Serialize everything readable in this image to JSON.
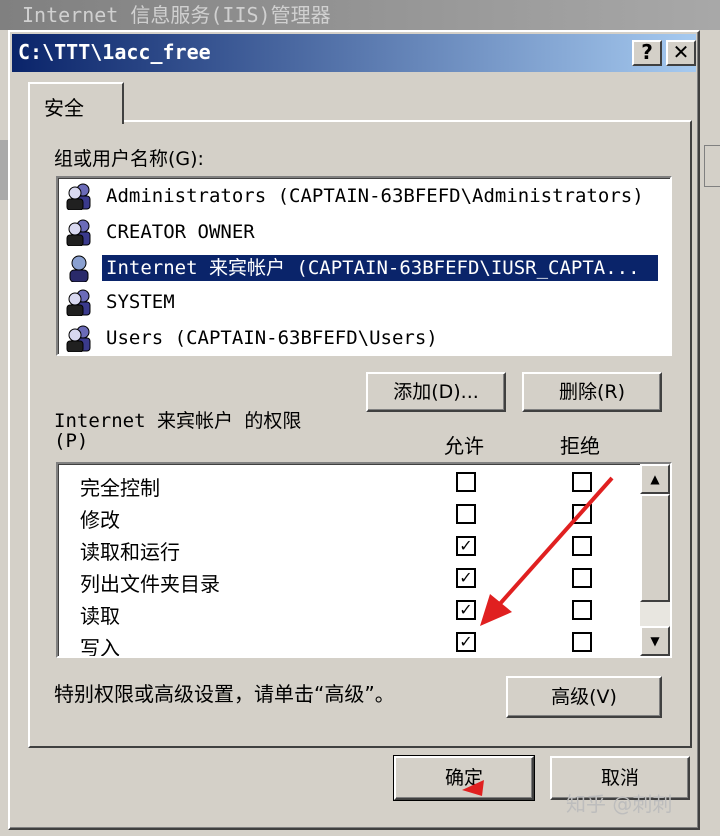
{
  "background_window": {
    "title": "Internet 信息服务(IIS)管理器"
  },
  "dialog": {
    "title": "C:\\TTT\\1acc_free",
    "help_button": "?",
    "close_button": "✕"
  },
  "tabs": [
    {
      "label": "安全"
    }
  ],
  "groups": {
    "label": "组或用户名称(G):",
    "items": [
      {
        "name": "Administrators (CAPTAIN-63BFEFD\\Administrators)",
        "icon": "user-group-icon",
        "selected": false
      },
      {
        "name": "CREATOR OWNER",
        "icon": "user-group-icon",
        "selected": false
      },
      {
        "name": "Internet 来宾帐户 (CAPTAIN-63BFEFD\\IUSR_CAPTA...",
        "icon": "user-icon",
        "selected": true
      },
      {
        "name": "SYSTEM",
        "icon": "user-group-icon",
        "selected": false
      },
      {
        "name": "Users (CAPTAIN-63BFEFD\\Users)",
        "icon": "user-group-icon",
        "selected": false
      }
    ],
    "add_button": "添加(D)...",
    "remove_button": "删除(R)"
  },
  "permissions": {
    "label_line1": "Internet 来宾帐户 的权限",
    "label_line2": "(P)",
    "allow_header": "允许",
    "deny_header": "拒绝",
    "rows": [
      {
        "name": "完全控制",
        "allow": false,
        "deny": false
      },
      {
        "name": "修改",
        "allow": false,
        "deny": false
      },
      {
        "name": "读取和运行",
        "allow": true,
        "deny": false
      },
      {
        "name": "列出文件夹目录",
        "allow": true,
        "deny": false
      },
      {
        "name": "读取",
        "allow": true,
        "deny": false
      },
      {
        "name": "写入",
        "allow": true,
        "deny": false
      }
    ]
  },
  "advanced": {
    "note": "特别权限或高级设置，请单击“高级”。",
    "button": "高级(V)"
  },
  "footer": {
    "ok_button": "确定",
    "cancel_button": "取消"
  },
  "watermark": "知乎 @刺刺",
  "colors": {
    "titlebar": "#0a246a",
    "selection": "#0a246a",
    "face": "#d4d0c8",
    "annotation_arrow": "#e02020"
  }
}
